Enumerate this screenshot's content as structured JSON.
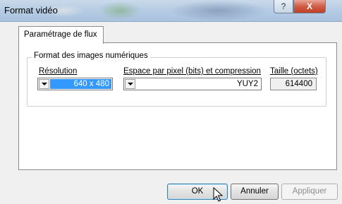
{
  "window": {
    "title": "Format vidéo",
    "help_glyph": "?",
    "close_glyph": "X"
  },
  "tabs": [
    {
      "label": "Paramétrage de flux",
      "selected": true
    }
  ],
  "group": {
    "title": "Format des images numériques",
    "resolution": {
      "label": "Résolution",
      "value": "640 x 480"
    },
    "compression": {
      "label": "Espace par pixel (bits) et compression",
      "value": "YUY2"
    },
    "size": {
      "label": "Taille (octets)",
      "value": "614400"
    }
  },
  "buttons": {
    "ok": "OK",
    "cancel": "Annuler",
    "apply": "Appliquer"
  },
  "colors": {
    "selection": "#3399ff",
    "close_button": "#c94a30"
  }
}
